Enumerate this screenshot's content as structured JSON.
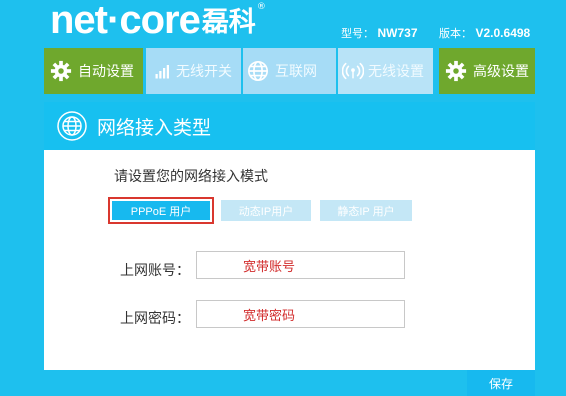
{
  "brand": {
    "name": "net·core",
    "name_cn": "磊科",
    "reg": "®"
  },
  "device": {
    "model_label": "型号：",
    "model": "NW737",
    "version_label": "版本：",
    "version": "V2.0.6498"
  },
  "nav": {
    "items": [
      {
        "label": "自动设置",
        "icon": "gear-icon"
      },
      {
        "label": "无线开关",
        "icon": "signal-bars-icon"
      },
      {
        "label": "互联网",
        "icon": "globe-icon"
      },
      {
        "label": "无线设置",
        "icon": "wifi-icon"
      },
      {
        "label": "高级设置",
        "icon": "gear-icon"
      }
    ]
  },
  "panel": {
    "title": "网络接入类型",
    "icon": "globe-icon"
  },
  "form": {
    "prompt": "请设置您的网络接入模式",
    "modes": [
      {
        "label": "PPPoE 用户",
        "selected": true
      },
      {
        "label": "动态IP用户",
        "selected": false
      },
      {
        "label": "静态IP 用户",
        "selected": false
      }
    ],
    "account_label": "上网账号：",
    "account_value": "宽带账号",
    "password_label": "上网密码：",
    "password_value": "宽带密码"
  },
  "actions": {
    "save_label": "保存"
  },
  "colors": {
    "background": "#1ec0ee",
    "accent": "#17b9ef",
    "green": "#6fa82d",
    "highlight": "#d9372e"
  }
}
